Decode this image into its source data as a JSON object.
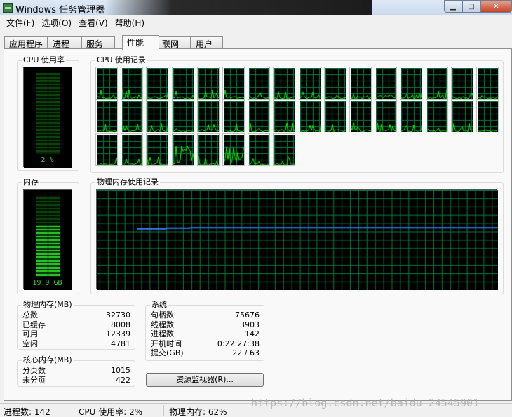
{
  "window": {
    "title": "Windows 任务管理器"
  },
  "menu": [
    "文件(F)",
    "选项(O)",
    "查看(V)",
    "帮助(H)"
  ],
  "tabs": [
    "应用程序",
    "进程",
    "服务",
    "性能",
    "联网",
    "用户"
  ],
  "active_tab": "性能",
  "cpu": {
    "title": "CPU 使用率",
    "value_label": "2 %",
    "usage": 0.02,
    "history_title": "CPU 使用记录",
    "core_count": 40
  },
  "memory": {
    "title": "内存",
    "value_label": "19.9 GB",
    "usage": 0.62,
    "history_title": "物理内存使用记录"
  },
  "physical_memory": {
    "title": "物理内存(MB)",
    "rows": [
      {
        "label": "总数",
        "value": "32730"
      },
      {
        "label": "已缓存",
        "value": "8008"
      },
      {
        "label": "可用",
        "value": "12339"
      },
      {
        "label": "空闲",
        "value": "4781"
      }
    ]
  },
  "kernel_memory": {
    "title": "核心内存(MB)",
    "rows": [
      {
        "label": "分页数",
        "value": "1015"
      },
      {
        "label": "未分页",
        "value": "422"
      }
    ]
  },
  "system": {
    "title": "系统",
    "rows": [
      {
        "label": "句柄数",
        "value": "75676"
      },
      {
        "label": "线程数",
        "value": "3903"
      },
      {
        "label": "进程数",
        "value": "142"
      },
      {
        "label": "开机时间",
        "value": "0:22:27:38"
      },
      {
        "label": "提交(GB)",
        "value": "22 / 63"
      }
    ]
  },
  "resource_monitor_button": "资源监视器(R)...",
  "statusbar": {
    "processes": "进程数: 142",
    "cpu": "CPU 使用率: 2%",
    "memory": "物理内存: 62%"
  },
  "watermark": "https://blog.csdn.net/baidu_24545901",
  "colors": {
    "graph_bg": "#000000",
    "grid": "#008040",
    "cpu_line": "#00ff00",
    "mem_line": "#3a7fff",
    "gauge_on": "#35ff35",
    "gauge_off": "#0c5a0c"
  }
}
